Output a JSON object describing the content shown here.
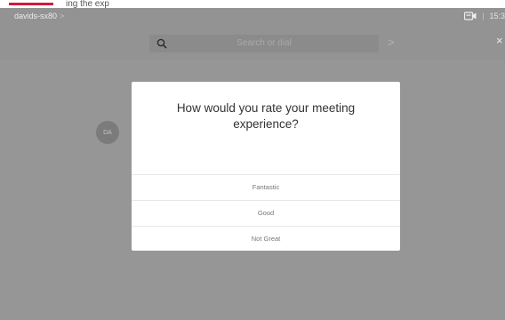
{
  "topbar": {
    "text": "ing the exp"
  },
  "header": {
    "device_name": "davids-sx80",
    "device_chevron": ">",
    "time": "15:3",
    "separator": "|",
    "camera_icon": "camera-icon"
  },
  "search": {
    "placeholder": "Search or dial",
    "arrow": ">",
    "close": "×"
  },
  "participant": {
    "initials": "DA"
  },
  "modal": {
    "title": "How would you rate your meeting experience?",
    "options": [
      {
        "label": "Fantastic"
      },
      {
        "label": "Good"
      },
      {
        "label": "Not Great"
      }
    ]
  },
  "colors": {
    "accent": "#d21a3a",
    "screen_bg": "#969696",
    "modal_bg": "#ffffff"
  }
}
